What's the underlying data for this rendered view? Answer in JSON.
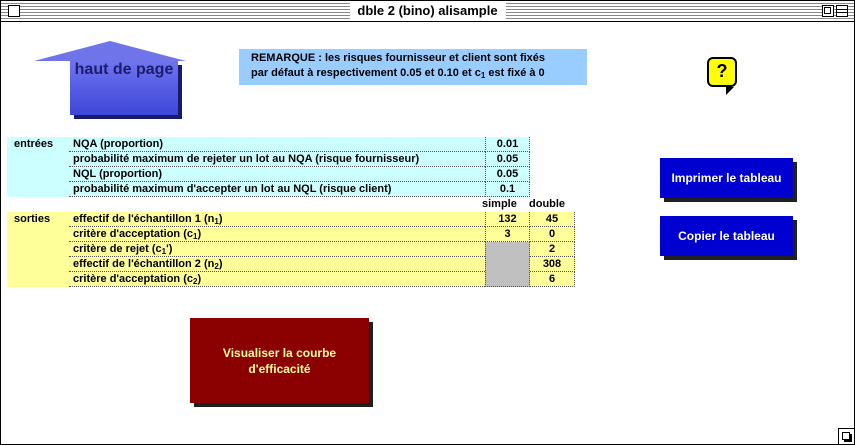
{
  "window": {
    "title": "dble 2 (bino) alisample"
  },
  "nav": {
    "top_label": "haut de page"
  },
  "remark": {
    "line1": "REMARQUE : les risques fournisseur et client sont fixés",
    "line2_a": "par défaut à respectivement 0.05 et 0.10 et c",
    "line2_sub": "1",
    "line2_b": " est fixé à 0"
  },
  "help": {
    "label": "?"
  },
  "buttons": {
    "print": "Imprimer le tableau",
    "copy": "Copier le tableau",
    "curve": "Visualiser la courbe d'efficacité"
  },
  "table": {
    "section_inputs": "entrées",
    "section_outputs": "sorties",
    "col_simple": "simple",
    "col_double": "double",
    "inputs": [
      {
        "label": "NQA (proportion)",
        "value": "0.01"
      },
      {
        "label": "probabilité maximum de rejeter un lot au NQA (risque fournisseur)",
        "value": "0.05"
      },
      {
        "label": "NQL (proportion)",
        "value": "0.05"
      },
      {
        "label": "probabilité maximum d'accepter un lot au NQL (risque client)",
        "value": "0.1"
      }
    ],
    "outputs": [
      {
        "label_a": "effectif de l'échantillon 1 (n",
        "sub": "1",
        "label_b": ")",
        "simple": "132",
        "double": "45"
      },
      {
        "label_a": "critère d'acceptation (c",
        "sub": "1",
        "label_b": ")",
        "simple": "3",
        "double": "0"
      },
      {
        "label_a": "critère de rejet (c",
        "sub": "1",
        "label_b": "')",
        "simple": "",
        "double": "2"
      },
      {
        "label_a": "effectif de l'échantillon 2 (n",
        "sub": "2",
        "label_b": ")",
        "simple": "",
        "double": "308"
      },
      {
        "label_a": "critère d'acceptation (c",
        "sub": "2",
        "label_b": ")",
        "simple": "",
        "double": "6"
      }
    ]
  }
}
